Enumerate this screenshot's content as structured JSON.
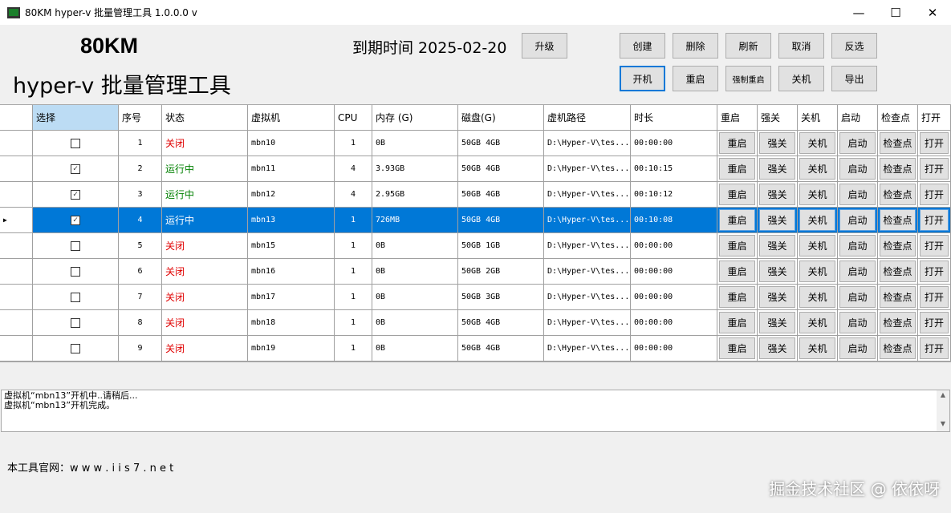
{
  "window": {
    "title": "80KM hyper-v 批量管理工具 1.0.0.0 v",
    "minimize": "—",
    "maximize": "☐",
    "close": "✕"
  },
  "brand": {
    "line1": "80KM",
    "line2": "hyper-v 批量管理工具"
  },
  "expire": "到期时间 2025-02-20",
  "upgrade": "升级",
  "toolbar": [
    "创建",
    "删除",
    "刷新",
    "取消",
    "反选",
    "开机",
    "重启",
    "强制重启",
    "关机",
    "导出"
  ],
  "columns": [
    "选择",
    "序号",
    "状态",
    "虚拟机",
    "CPU",
    "内存 (G)",
    "磁盘(G)",
    "虚机路径",
    "时长",
    "重启",
    "强关",
    "关机",
    "启动",
    "检查点",
    "打开"
  ],
  "row_buttons": [
    "重启",
    "强关",
    "关机",
    "启动",
    "检查点",
    "打开"
  ],
  "status_colors": {
    "关闭": "#e00000",
    "运行中": "#008000"
  },
  "selected_row": 3,
  "rows": [
    {
      "checked": false,
      "no": "1",
      "status": "关闭",
      "vm": "mbn10",
      "cpu": "1",
      "mem": "0B",
      "disk": "50GB 4GB",
      "path": "D:\\Hyper-V\\tes...",
      "time": "00:00:00"
    },
    {
      "checked": true,
      "no": "2",
      "status": "运行中",
      "vm": "mbn11",
      "cpu": "4",
      "mem": "3.93GB",
      "disk": "50GB 4GB",
      "path": "D:\\Hyper-V\\tes...",
      "time": "00:10:15"
    },
    {
      "checked": true,
      "no": "3",
      "status": "运行中",
      "vm": "mbn12",
      "cpu": "4",
      "mem": "2.95GB",
      "disk": "50GB 4GB",
      "path": "D:\\Hyper-V\\tes...",
      "time": "00:10:12"
    },
    {
      "checked": true,
      "no": "4",
      "status": "运行中",
      "vm": "mbn13",
      "cpu": "1",
      "mem": "726MB",
      "disk": "50GB 4GB",
      "path": "D:\\Hyper-V\\tes...",
      "time": "00:10:08"
    },
    {
      "checked": false,
      "no": "5",
      "status": "关闭",
      "vm": "mbn15",
      "cpu": "1",
      "mem": "0B",
      "disk": "50GB 1GB",
      "path": "D:\\Hyper-V\\tes...",
      "time": "00:00:00"
    },
    {
      "checked": false,
      "no": "6",
      "status": "关闭",
      "vm": "mbn16",
      "cpu": "1",
      "mem": "0B",
      "disk": "50GB 2GB",
      "path": "D:\\Hyper-V\\tes...",
      "time": "00:00:00"
    },
    {
      "checked": false,
      "no": "7",
      "status": "关闭",
      "vm": "mbn17",
      "cpu": "1",
      "mem": "0B",
      "disk": "50GB 3GB",
      "path": "D:\\Hyper-V\\tes...",
      "time": "00:00:00"
    },
    {
      "checked": false,
      "no": "8",
      "status": "关闭",
      "vm": "mbn18",
      "cpu": "1",
      "mem": "0B",
      "disk": "50GB 4GB",
      "path": "D:\\Hyper-V\\tes...",
      "time": "00:00:00"
    },
    {
      "checked": false,
      "no": "9",
      "status": "关闭",
      "vm": "mbn19",
      "cpu": "1",
      "mem": "0B",
      "disk": "50GB 4GB",
      "path": "D:\\Hyper-V\\tes...",
      "time": "00:00:00"
    }
  ],
  "log": "虚拟机“mbn13”开机中..请稍后...\n虚拟机“mbn13”开机完成。",
  "footer": "本工具官网：w w w . i i s 7 . n e t",
  "watermark": "掘金技术社区 @ 依依呀"
}
